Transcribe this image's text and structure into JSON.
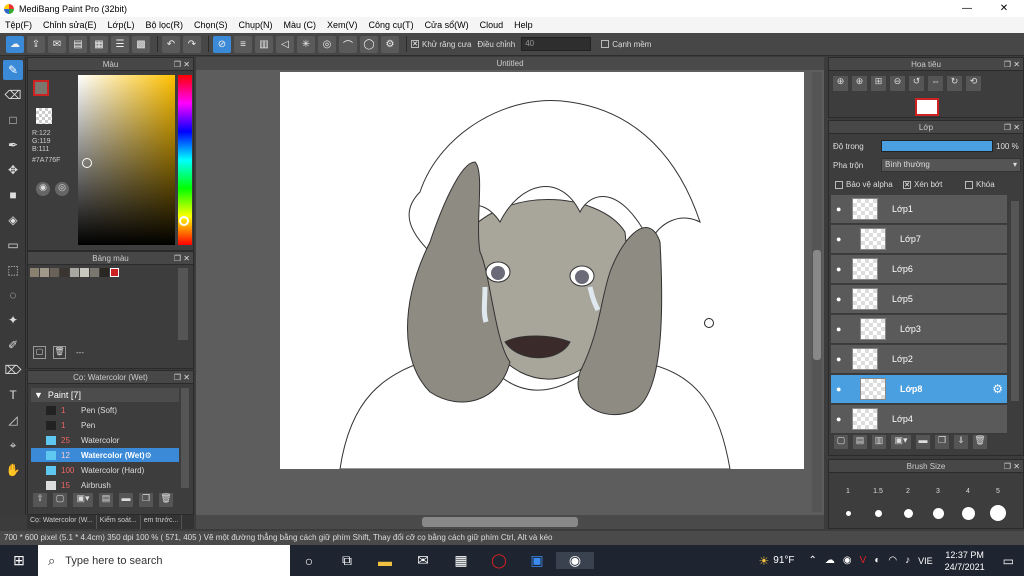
{
  "window": {
    "title": "MediBang Paint Pro (32bit)",
    "minimize": "—",
    "maximize": "❐",
    "close": "✕"
  },
  "menu": [
    "Tệp(F)",
    "Chỉnh sửa(E)",
    "Lớp(L)",
    "Bộ lọc(R)",
    "Chọn(S)",
    "Chụp(N)",
    "Màu (C)",
    "Xem(V)",
    "Công cụ(T)",
    "Cửa sổ(W)",
    "Cloud",
    "Help"
  ],
  "toolbar": {
    "antialias_label": "Khử răng cưa",
    "correction_label": "Điều chỉnh",
    "correction_value": "40",
    "edge_label": "Cạnh mềm"
  },
  "color_panel": {
    "title": "Màu",
    "r": "R:122",
    "g": "G:119",
    "b": "B:111",
    "hex": "#7A776F",
    "current_color": "#7A776F",
    "accent": "#cc2222"
  },
  "palette_panel": {
    "title": "Bảng màu",
    "footer_text": "---",
    "swatches": [
      "#8a8070",
      "#a09888",
      "#6a6258",
      "#3a3530",
      "#a8a8a0",
      "#c8c8c0",
      "#7a776f",
      "#2a2622",
      "#cc2222"
    ]
  },
  "brush_panel": {
    "title": "Cọ: Watercolor (Wet)",
    "group": "Paint [7]",
    "items": [
      {
        "size": "1",
        "name": "Pen (Soft)",
        "color": "#222222"
      },
      {
        "size": "1",
        "name": "Pen",
        "color": "#222222"
      },
      {
        "size": "25",
        "name": "Watercolor",
        "color": "#5fc8f0"
      },
      {
        "size": "12",
        "name": "Watercolor (Wet)",
        "color": "#5fc8f0"
      },
      {
        "size": "100",
        "name": "Watercolor (Hard)",
        "color": "#5fc8f0"
      },
      {
        "size": "15",
        "name": "Airbrush",
        "color": "#dddddd"
      }
    ]
  },
  "bottom_tabs": [
    "Cọ: Watercolor (W...",
    "Kiểm soát...",
    "em trước..."
  ],
  "document": {
    "tab_title": "Untitled"
  },
  "status": {
    "text": "700 * 600 pixel   (5.1 * 4.4cm)   350 dpi   100 %   ( 571, 405 )   Vẽ một đường thẳng bằng cách giữ phím Shift, Thay đổi cỡ cọ bằng cách giữ phím Ctrl, Alt và kéo"
  },
  "navigator": {
    "title": "Hoa tiêu"
  },
  "layer_panel": {
    "title": "Lớp",
    "opacity_label": "Độ trong",
    "opacity_value": "100 %",
    "opacity": 1.0,
    "blend_label": "Pha trộn",
    "blend_value": "Bình thường",
    "protect_alpha": "Bảo vệ alpha",
    "clipping": "Xén bớt",
    "lock": "Khóa",
    "layers": [
      {
        "name": "Lớp1",
        "selected": false,
        "indent": false
      },
      {
        "name": "Lớp7",
        "selected": false,
        "indent": true
      },
      {
        "name": "Lớp6",
        "selected": false,
        "indent": false
      },
      {
        "name": "Lớp5",
        "selected": false,
        "indent": false
      },
      {
        "name": "Lớp3",
        "selected": false,
        "indent": true
      },
      {
        "name": "Lớp2",
        "selected": false,
        "indent": false
      },
      {
        "name": "Lớp8",
        "selected": true,
        "indent": true
      },
      {
        "name": "Lớp4",
        "selected": false,
        "indent": false
      }
    ]
  },
  "brush_size_panel": {
    "title": "Brush Size",
    "sizes": [
      "1",
      "1.5",
      "2",
      "3",
      "4",
      "5"
    ]
  },
  "taskbar": {
    "search_placeholder": "Type here to search",
    "weather": "91°F",
    "language": "VIE",
    "time": "12:37 PM",
    "date": "24/7/2021"
  }
}
